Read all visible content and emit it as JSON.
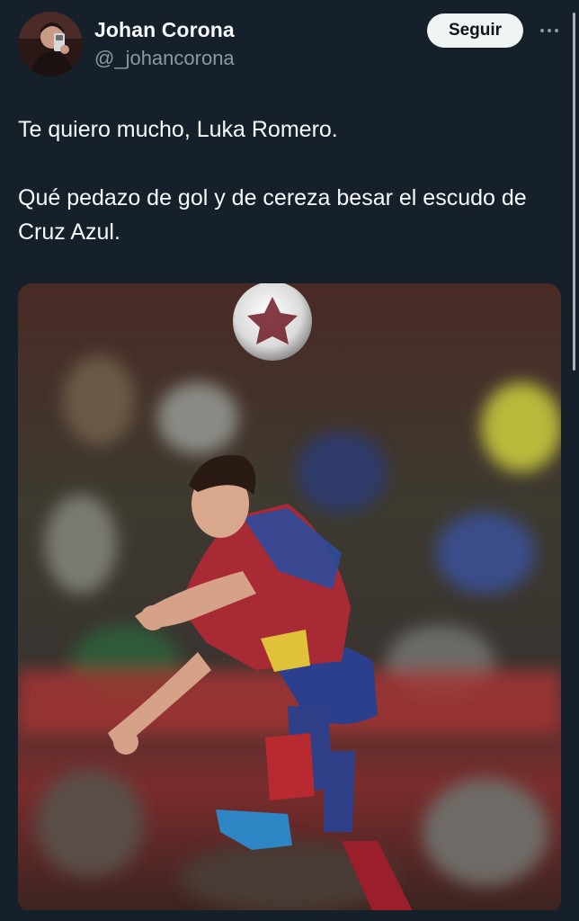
{
  "author": {
    "name": "Johan Corona",
    "handle": "@_johancorona"
  },
  "actions": {
    "follow_label": "Seguir",
    "more_icon": "more-horizontal-icon"
  },
  "tweet": {
    "lines": [
      "Te quiero mucho, Luka Romero.",
      "Qué pedazo de gol y de cereza besar el escudo de Cruz Azul."
    ]
  },
  "media": {
    "kind": "photo"
  },
  "colors": {
    "background": "#15202b",
    "text_primary": "#f7f9f9",
    "text_secondary": "#8b98a5",
    "button_bg": "#eff3f4",
    "button_text": "#0f1419"
  }
}
